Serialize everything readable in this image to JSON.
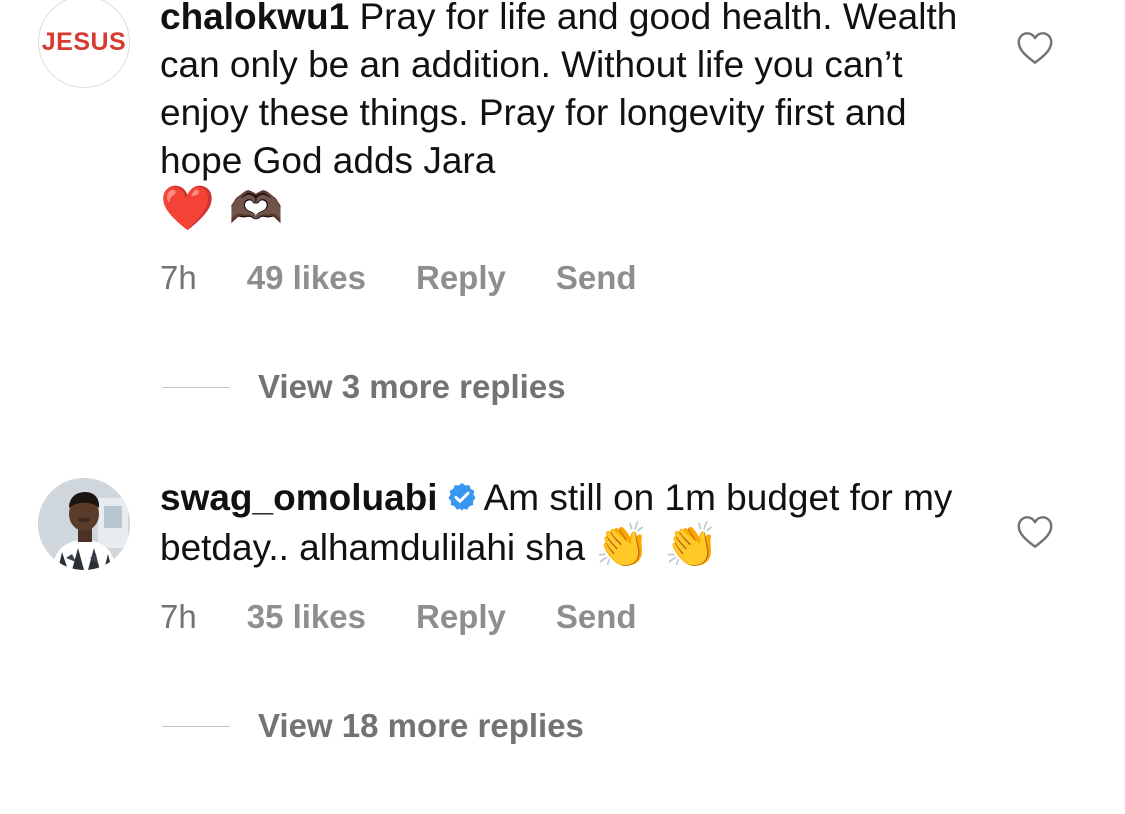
{
  "comments": [
    {
      "avatar_text": "JESUS",
      "username": "chalokwu1",
      "text": "Pray for life and good health. Wealth can only be an addition. Without life you can’t enjoy these things. Pray for longevity first and hope God adds Jara",
      "emojis": "❤️ 🫶🏿",
      "time": "7h",
      "likes": "49 likes",
      "reply_label": "Reply",
      "send_label": "Send",
      "view_replies": "View 3 more replies",
      "like_icon": "heart-outline-icon"
    },
    {
      "avatar_text": "",
      "username": "swag_omoluabi",
      "verified": true,
      "text": "Am still on 1m budget for my betday.. alhamdulilahi sha",
      "emojis": "👏 👏",
      "time": "7h",
      "likes": "35 likes",
      "reply_label": "Reply",
      "send_label": "Send",
      "view_replies": "View 18 more replies",
      "like_icon": "heart-outline-icon"
    }
  ],
  "colors": {
    "text": "#111111",
    "meta": "#8e8e8e",
    "verified": "#3897f0",
    "avatar_brand": "#d63b2f"
  }
}
